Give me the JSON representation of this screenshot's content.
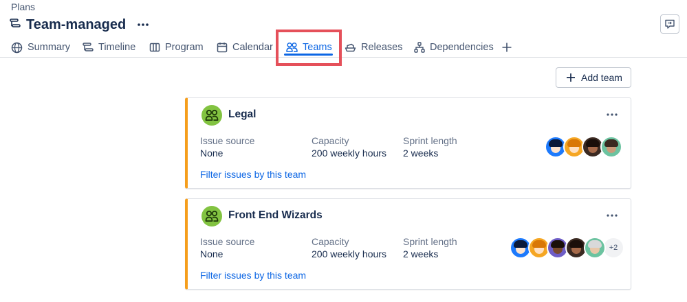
{
  "breadcrumb": "Plans",
  "page": {
    "title": "Team-managed",
    "icon": "plan-icon"
  },
  "tabs": [
    {
      "label": "Summary",
      "icon": "globe-icon",
      "active": false
    },
    {
      "label": "Timeline",
      "icon": "timeline-icon",
      "active": false
    },
    {
      "label": "Program",
      "icon": "board-icon",
      "active": false
    },
    {
      "label": "Calendar",
      "icon": "calendar-icon",
      "active": false
    },
    {
      "label": "Teams",
      "icon": "people-icon",
      "active": true
    },
    {
      "label": "Releases",
      "icon": "ship-icon",
      "active": false
    },
    {
      "label": "Dependencies",
      "icon": "hierarchy-icon",
      "active": false
    }
  ],
  "add_tab_icon": "plus-icon",
  "add_team_label": "Add team",
  "field_labels": {
    "issue_source": "Issue source",
    "capacity": "Capacity",
    "sprint_length": "Sprint length"
  },
  "teams": [
    {
      "name": "Legal",
      "issue_source": "None",
      "capacity": "200 weekly hours",
      "sprint_length": "2 weeks",
      "filter_label": "Filter issues by this team",
      "avatar_count": 4
    },
    {
      "name": "Front End Wizards",
      "issue_source": "None",
      "capacity": "200 weekly hours",
      "sprint_length": "2 weeks",
      "filter_label": "Filter issues by this team",
      "avatar_count": 5,
      "more_members": "+2"
    }
  ],
  "colors": {
    "accent": "#0c66e4",
    "card_border": "#f59e1d",
    "team_icon_bg": "#82c341",
    "highlight": "#e5505a"
  }
}
